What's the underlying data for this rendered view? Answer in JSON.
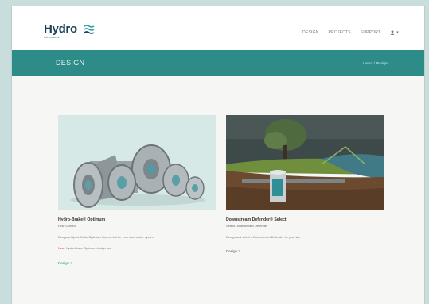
{
  "header": {
    "logo_word": "Hydro",
    "logo_sub": "International",
    "nav": [
      {
        "label": "DESIGN"
      },
      {
        "label": "PROJECTS"
      },
      {
        "label": "SUPPORT"
      }
    ],
    "user_label": "▾"
  },
  "banner": {
    "title": "DESIGN",
    "breadcrumb": [
      "Home",
      "Design"
    ]
  },
  "cards": [
    {
      "title": "Hydro-Brake® Optimum",
      "subtitle": "Flow Control",
      "description": "Design a Hydro-Brake Optimum flow control for your stormwater system",
      "note_highlight": "New:",
      "note_rest": "Hydro-Brake Optimum design tool",
      "link": "Design >"
    },
    {
      "title": "Downstream Defender® Select",
      "subtitle": "Select Downstream Defender",
      "description": "Design and select a Downstream Defender for your site",
      "link": "Design >"
    }
  ],
  "colors": {
    "page_bg": "#c9dedc",
    "teal_banner": "#2d8c87",
    "logo_navy": "#1b3f57"
  },
  "icons": [
    "user-icon",
    "logo-waves-icon"
  ]
}
